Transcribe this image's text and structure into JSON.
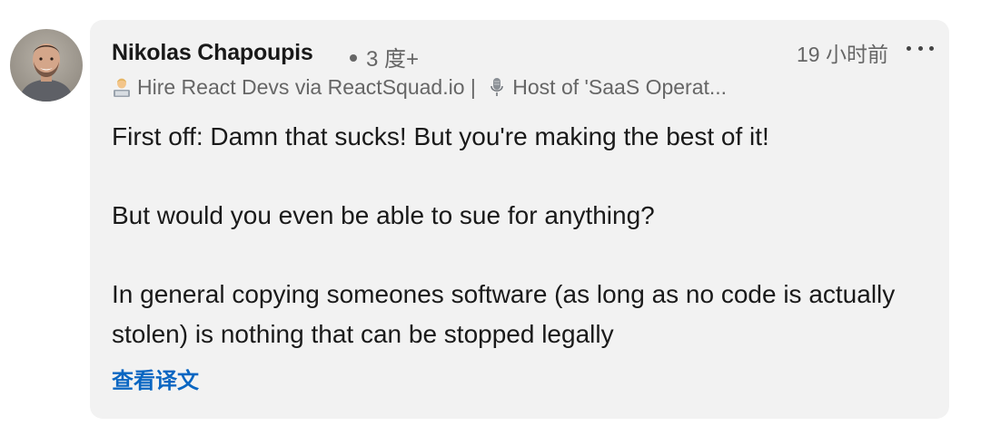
{
  "comment": {
    "author": {
      "name": "Nikolas Chapoupis",
      "degree": "3 度+",
      "headline_part1": "Hire React Devs via ReactSquad.io |",
      "headline_part2": "Host of 'SaaS Operat...",
      "headline_icons": [
        "technologist-emoji",
        "microphone-emoji"
      ]
    },
    "timestamp": "19 小时前",
    "more_label": "•••",
    "paragraphs": [
      "First off: Damn that sucks! But you're making the best of it!",
      "But would you even be able to sue for anything?",
      "In general copying someones software (as long as no code is actually stolen) is nothing that can be stopped legally"
    ],
    "translate_label": "查看译文"
  },
  "colors": {
    "bubble_background": "#f2f2f2",
    "link": "#0a66c2",
    "primary_text": "#191919",
    "secondary_text": "#666666"
  }
}
